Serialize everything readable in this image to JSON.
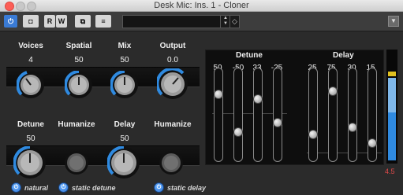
{
  "window": {
    "title": "Desk Mic: Ins. 1 - Cloner"
  },
  "toolbar": {
    "read_label": "R",
    "write_label": "W",
    "preset_value": ""
  },
  "knobs": [
    {
      "label": "Voices",
      "value": "4"
    },
    {
      "label": "Spatial",
      "value": "50"
    },
    {
      "label": "Mix",
      "value": "50"
    },
    {
      "label": "Output",
      "value": "0.0"
    },
    {
      "label": "Detune",
      "value": "50"
    },
    {
      "label": "Humanize",
      "value": ""
    },
    {
      "label": "Delay",
      "value": "50"
    },
    {
      "label": "Humanize",
      "value": ""
    }
  ],
  "options": {
    "natural": "natural",
    "static_detune": "static detune",
    "static_delay": "static delay"
  },
  "display": {
    "detune_label": "Detune",
    "delay_label": "Delay",
    "detune_values": [
      "50",
      "-50",
      "33",
      "-25"
    ],
    "delay_values": [
      "25",
      "75",
      "30",
      "15"
    ],
    "output_level": "4.5"
  },
  "icons": {
    "power": "power-icon",
    "bypass": "bypass-icon",
    "compare": "ab-compare-icon",
    "menu": "menu-icon",
    "load": "load-preset-icon",
    "collapse": "chevron-down-icon"
  },
  "colors": {
    "accent": "#3a7bd5",
    "meter_level": "#2f8ae0",
    "meter_peak": "#e0c020",
    "meter_readout": "#e04a4a"
  }
}
